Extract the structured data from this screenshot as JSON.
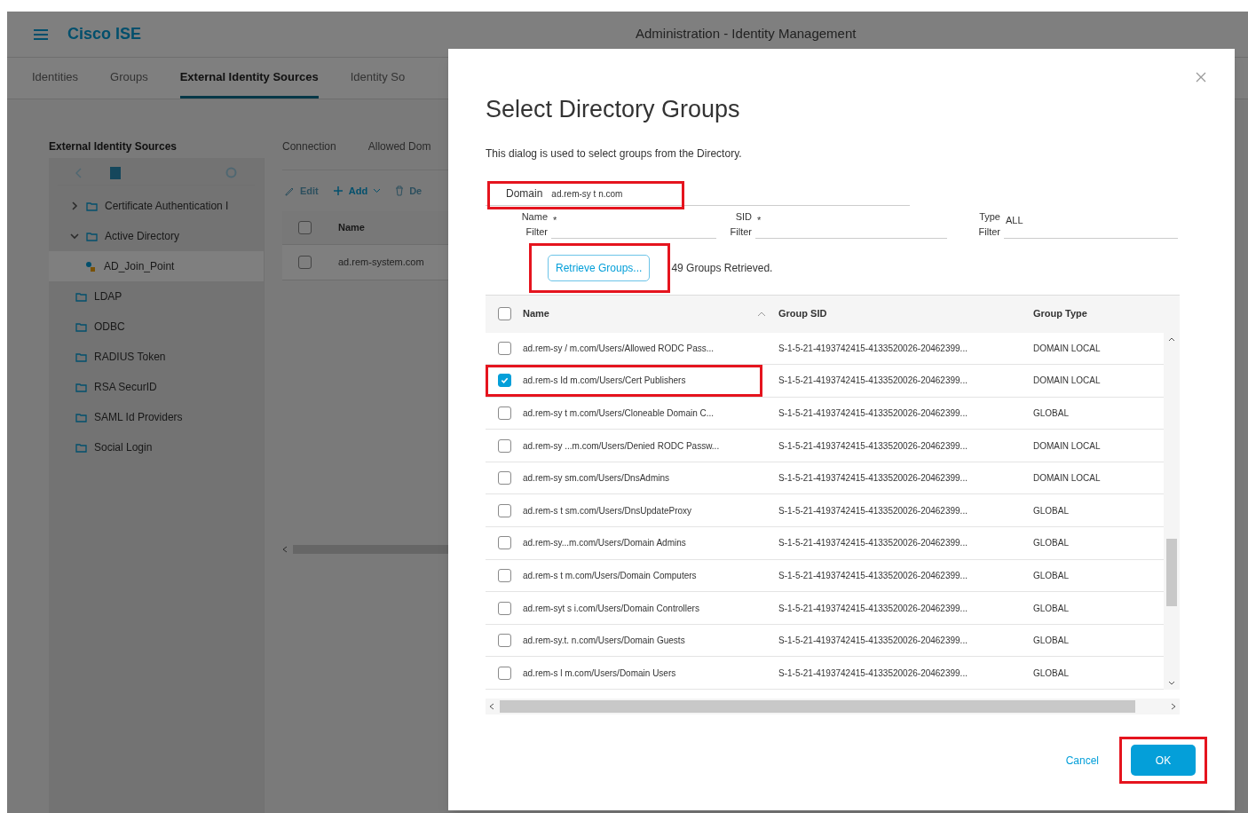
{
  "app": {
    "logo": "Cisco ISE",
    "title": "Administration - Identity Management"
  },
  "nav_tabs": [
    {
      "label": "Identities",
      "selected": false
    },
    {
      "label": "Groups",
      "selected": false
    },
    {
      "label": "External Identity Sources",
      "selected": true
    },
    {
      "label": "Identity So",
      "selected": false
    }
  ],
  "sidebar": {
    "title": "External Identity Sources",
    "items": [
      {
        "label": "Certificate Authentication I",
        "expanded": false
      },
      {
        "label": "Active Directory",
        "expanded": true,
        "children": [
          {
            "label": "AD_Join_Point",
            "selected": true
          }
        ]
      },
      {
        "label": "LDAP"
      },
      {
        "label": "ODBC"
      },
      {
        "label": "RADIUS Token"
      },
      {
        "label": "RSA SecurID"
      },
      {
        "label": "SAML Id Providers"
      },
      {
        "label": "Social Login"
      }
    ]
  },
  "content": {
    "tabs": [
      "Connection",
      "Allowed Dom"
    ],
    "toolbar": [
      {
        "kind": "edit",
        "label": "Edit",
        "disabled": true
      },
      {
        "kind": "add",
        "label": "Add",
        "disabled": false
      },
      {
        "kind": "delete",
        "label": "De",
        "disabled": true
      }
    ],
    "table": {
      "columns": [
        "Name"
      ],
      "header_checked": false,
      "rows": [
        {
          "cells": [
            "ad.rem-system.com"
          ],
          "checked": false
        }
      ]
    }
  },
  "dialog": {
    "title": "Select Directory Groups",
    "description": "This dialog is used to select groups from the Directory.",
    "domain": {
      "label": "Domain",
      "value": "ad.rem-sy t n.com",
      "highlighted": true
    },
    "filters": [
      {
        "label": "Name Filter",
        "value": "*"
      },
      {
        "label": "SID Filter",
        "value": "*"
      },
      {
        "label": "Type Filter",
        "value": "ALL"
      }
    ],
    "retrieve": {
      "label": "Retrieve Groups...",
      "highlighted": true
    },
    "status": "49 Groups Retrieved.",
    "table": {
      "columns": [
        "Name",
        "Group SID",
        "Group Type"
      ],
      "header_checked": false,
      "rows": [
        {
          "name": "ad.rem-sy / m.com/Users/Allowed RODC Pass...",
          "sid": "S-1-5-21-4193742415-4133520026-20462399...",
          "type": "DOMAIN LOCAL",
          "checked": false,
          "highlighted": false
        },
        {
          "name": "ad.rem-s Id m.com/Users/Cert Publishers",
          "sid": "S-1-5-21-4193742415-4133520026-20462399...",
          "type": "DOMAIN LOCAL",
          "checked": true,
          "highlighted": true
        },
        {
          "name": "ad.rem-sy t m.com/Users/Cloneable Domain C...",
          "sid": "S-1-5-21-4193742415-4133520026-20462399...",
          "type": "GLOBAL",
          "checked": false,
          "highlighted": false
        },
        {
          "name": "ad.rem-sy ...m.com/Users/Denied RODC Passw...",
          "sid": "S-1-5-21-4193742415-4133520026-20462399...",
          "type": "DOMAIN LOCAL",
          "checked": false,
          "highlighted": false
        },
        {
          "name": "ad.rem-sy sm.com/Users/DnsAdmins",
          "sid": "S-1-5-21-4193742415-4133520026-20462399...",
          "type": "DOMAIN LOCAL",
          "checked": false,
          "highlighted": false
        },
        {
          "name": "ad.rem-s t sm.com/Users/DnsUpdateProxy",
          "sid": "S-1-5-21-4193742415-4133520026-20462399...",
          "type": "GLOBAL",
          "checked": false,
          "highlighted": false
        },
        {
          "name": "ad.rem-sy...m.com/Users/Domain Admins",
          "sid": "S-1-5-21-4193742415-4133520026-20462399...",
          "type": "GLOBAL",
          "checked": false,
          "highlighted": false
        },
        {
          "name": "ad.rem-s t m.com/Users/Domain Computers",
          "sid": "S-1-5-21-4193742415-4133520026-20462399...",
          "type": "GLOBAL",
          "checked": false,
          "highlighted": false
        },
        {
          "name": "ad.rem-syt s i.com/Users/Domain Controllers",
          "sid": "S-1-5-21-4193742415-4133520026-20462399...",
          "type": "GLOBAL",
          "checked": false,
          "highlighted": false
        },
        {
          "name": "ad.rem-sy.t. n.com/Users/Domain Guests",
          "sid": "S-1-5-21-4193742415-4133520026-20462399...",
          "type": "GLOBAL",
          "checked": false,
          "highlighted": false
        },
        {
          "name": "ad.rem-s l m.com/Users/Domain Users",
          "sid": "S-1-5-21-4193742415-4133520026-20462399...",
          "type": "GLOBAL",
          "checked": false,
          "highlighted": false
        }
      ]
    },
    "cancel": "Cancel",
    "ok": {
      "label": "OK",
      "highlighted": true
    }
  }
}
